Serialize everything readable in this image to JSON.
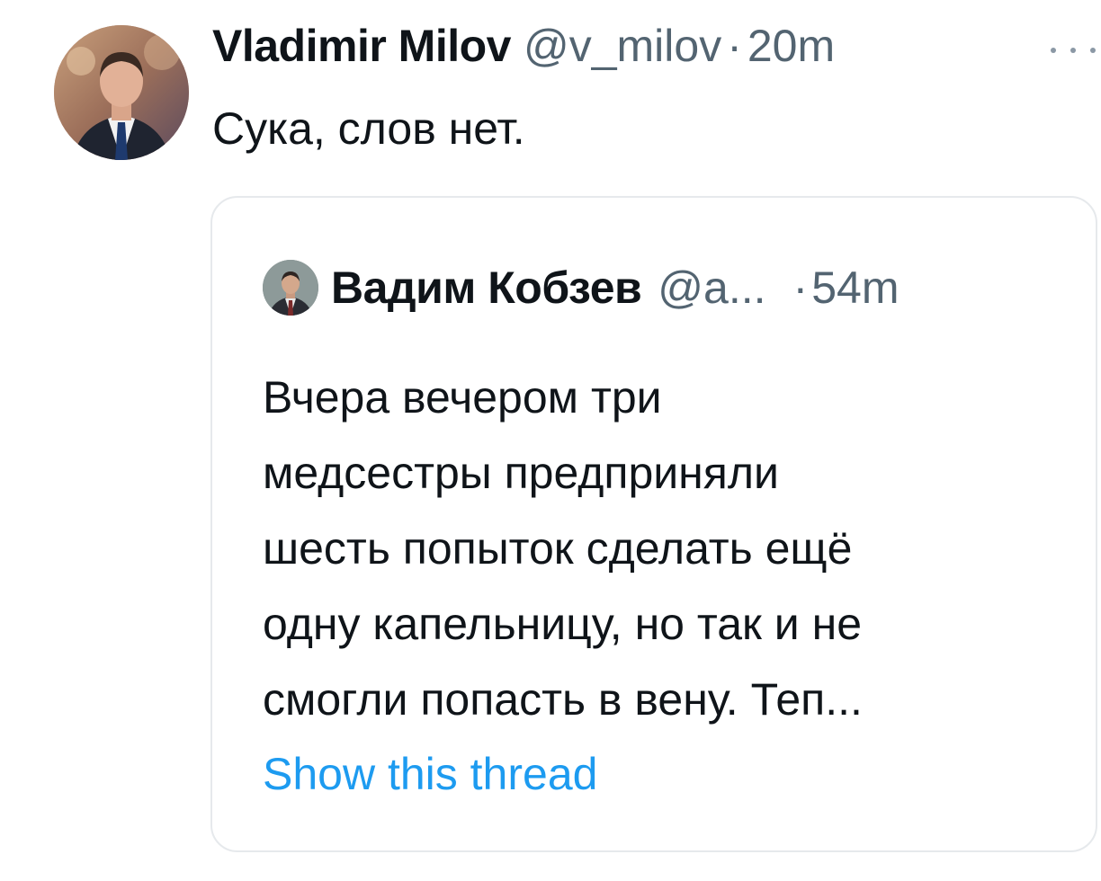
{
  "tweet": {
    "author": {
      "display_name": "Vladimir Milov",
      "handle": "@v_milov",
      "avatar_icon": "user-avatar"
    },
    "separator": "·",
    "time": "20m",
    "more_icon": "more-horizontal-icon",
    "text": "Сука, слов нет."
  },
  "quote": {
    "author": {
      "display_name": "Вадим Кобзев",
      "handle": "@a...",
      "avatar_icon": "user-avatar"
    },
    "separator": "·",
    "time": "54m",
    "text_lines": [
      "Вчера вечером три",
      "медсестры предприняли",
      "шесть попыток сделать ещё",
      "одну капельницу, но так и не",
      "смогли попасть в вену. Теп..."
    ],
    "show_thread": "Show this thread"
  },
  "colors": {
    "text_primary": "#0f1419",
    "text_secondary": "#536471",
    "link": "#1d9bf0",
    "border": "#e6e9ec"
  }
}
